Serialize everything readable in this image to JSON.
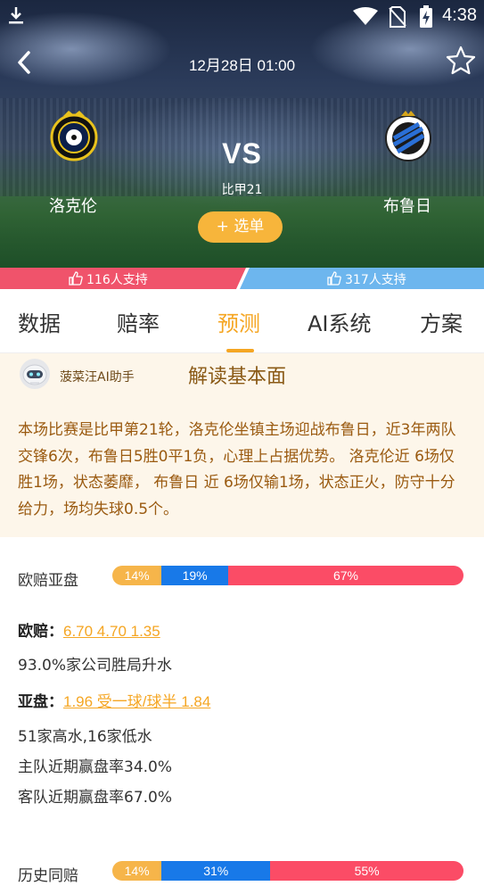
{
  "status": {
    "time": "4:38"
  },
  "match": {
    "datetime": "12月28日 01:00",
    "home_team": "洛克伦",
    "away_team": "布鲁日",
    "vs_label": "VS",
    "league": "比甲21",
    "select_button": "+ 选单"
  },
  "support": {
    "home": "116人支持",
    "away": "317人支持"
  },
  "tabs": [
    "数据",
    "赔率",
    "预测",
    "AI系统",
    "方案"
  ],
  "active_tab": "预测",
  "ai": {
    "assistant_name": "菠菜汪AI助手",
    "heading": "解读基本面",
    "description": "本场比赛是比甲第21轮，洛克伦坐镇主场迎战布鲁日，近3年两队交锋6次，布鲁日5胜0平1负，心理上占据优势。 洛克伦近 6场仅胜1场，状态萎靡， 布鲁日 近 6场仅输1场，状态正火，防守十分给力，场均失球0.5个。"
  },
  "odds": {
    "euro_asian": {
      "label": "欧赔亚盘",
      "segments": [
        {
          "text": "14%",
          "value": 14
        },
        {
          "text": "19%",
          "value": 19
        },
        {
          "text": "67%",
          "value": 67
        }
      ]
    },
    "euro_line": {
      "label": "欧赔：",
      "value": "6.70 4.70 1.35"
    },
    "euro_note": "93.0%家公司胜局升水",
    "asian_line": {
      "label": "亚盘：",
      "value": "1.96 受一球/球半 1.84"
    },
    "asian_notes": [
      "51家高水,16家低水",
      "主队近期赢盘率34.0%",
      "客队近期赢盘率67.0%"
    ],
    "history": {
      "label": "历史同赔",
      "segments": [
        {
          "text": "14%",
          "value": 14
        },
        {
          "text": "31%",
          "value": 31
        },
        {
          "text": "55%",
          "value": 55
        }
      ]
    }
  },
  "colors": {
    "accent": "#f5a623",
    "home_support": "#f0536b",
    "away_support": "#6db6ee",
    "win": "#f6b54a",
    "draw": "#1879e8",
    "lose": "#fb4c66"
  }
}
